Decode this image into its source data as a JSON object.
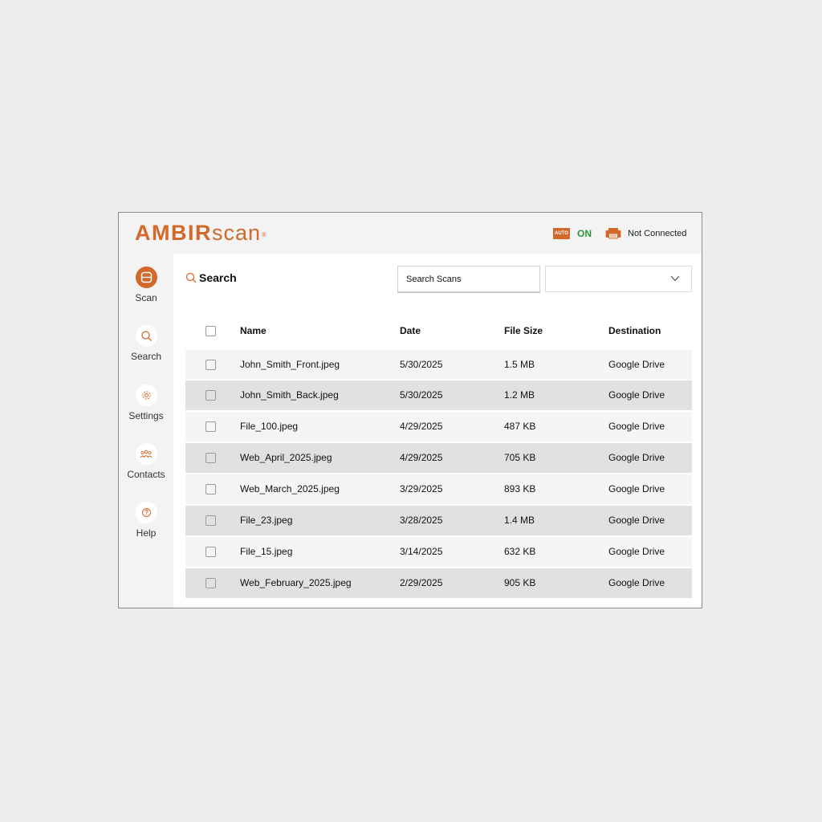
{
  "header": {
    "logo_brand": "AMBIR",
    "logo_suffix": "scan",
    "logo_reg": "®",
    "auto_badge": "AUTO",
    "auto_status": "ON",
    "connection_status": "Not Connected"
  },
  "colors": {
    "brand": "#d2692a",
    "status_on": "#2d9a3a",
    "row_light": "#f5f5f5",
    "row_dark": "#e1e1e1"
  },
  "sidebar": {
    "items": [
      {
        "label": "Scan",
        "icon": "scan-icon",
        "active": true
      },
      {
        "label": "Search",
        "icon": "search-icon",
        "active": false
      },
      {
        "label": "Settings",
        "icon": "gear-icon",
        "active": false
      },
      {
        "label": "Contacts",
        "icon": "contacts-icon",
        "active": false
      },
      {
        "label": "Help",
        "icon": "help-icon",
        "active": false
      }
    ]
  },
  "main": {
    "title": "Search",
    "search_placeholder": "Search Scans",
    "dropdown_value": ""
  },
  "table": {
    "columns": [
      "Name",
      "Date",
      "File Size",
      "Destination"
    ],
    "rows": [
      {
        "name": "John_Smith_Front.jpeg",
        "date": "5/30/2025",
        "size": "1.5 MB",
        "destination": "Google Drive"
      },
      {
        "name": "John_Smith_Back.jpeg",
        "date": "5/30/2025",
        "size": "1.2 MB",
        "destination": "Google Drive"
      },
      {
        "name": "File_100.jpeg",
        "date": "4/29/2025",
        "size": "487 KB",
        "destination": "Google Drive"
      },
      {
        "name": "Web_April_2025.jpeg",
        "date": "4/29/2025",
        "size": "705 KB",
        "destination": "Google Drive"
      },
      {
        "name": "Web_March_2025.jpeg",
        "date": "3/29/2025",
        "size": "893 KB",
        "destination": "Google Drive"
      },
      {
        "name": "File_23.jpeg",
        "date": "3/28/2025",
        "size": "1.4 MB",
        "destination": "Google Drive"
      },
      {
        "name": "File_15.jpeg",
        "date": "3/14/2025",
        "size": "632 KB",
        "destination": "Google Drive"
      },
      {
        "name": "Web_February_2025.jpeg",
        "date": "2/29/2025",
        "size": "905 KB",
        "destination": "Google Drive"
      }
    ]
  }
}
